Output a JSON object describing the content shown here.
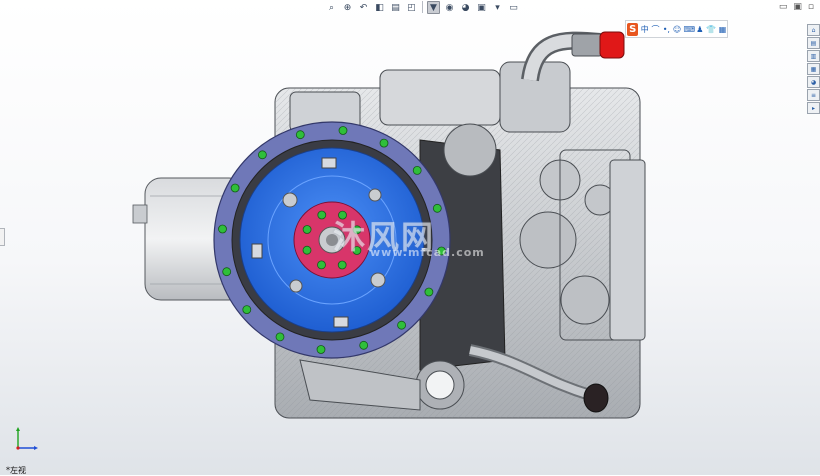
{
  "view_label": "*左视",
  "watermark": {
    "text": "沐风网",
    "url": "www.mfcad.com"
  },
  "hud_icons": [
    "zoom-to-fit-icon",
    "zoom-area-icon",
    "previous-view-icon",
    "section-view-icon",
    "dynamic-annotation-icon",
    "view-orientation-icon",
    "display-style-icon",
    "hide-show-items-icon",
    "edit-appearance-icon",
    "apply-scene-icon",
    "view-settings-icon",
    "display-icon"
  ],
  "ime_toolbar": {
    "logo": "S",
    "icons": [
      "中",
      "⌒",
      "•,",
      "☺",
      "⌨",
      "♟",
      "👕",
      "▦"
    ]
  },
  "task_pane": [
    "home-icon",
    "resources-icon",
    "design-library-icon",
    "file-explorer-icon",
    "appearances-icon",
    "custom-properties-icon",
    "collapse-icon"
  ],
  "window_controls": [
    "▭",
    "▣",
    "▫"
  ],
  "colors": {
    "flywheel_ring": "#6f78b8",
    "flywheel_disc": "#2f73e6",
    "hub": "#d8356a",
    "bolts": "#2fbf3a",
    "intake_cap": "#e01818"
  }
}
